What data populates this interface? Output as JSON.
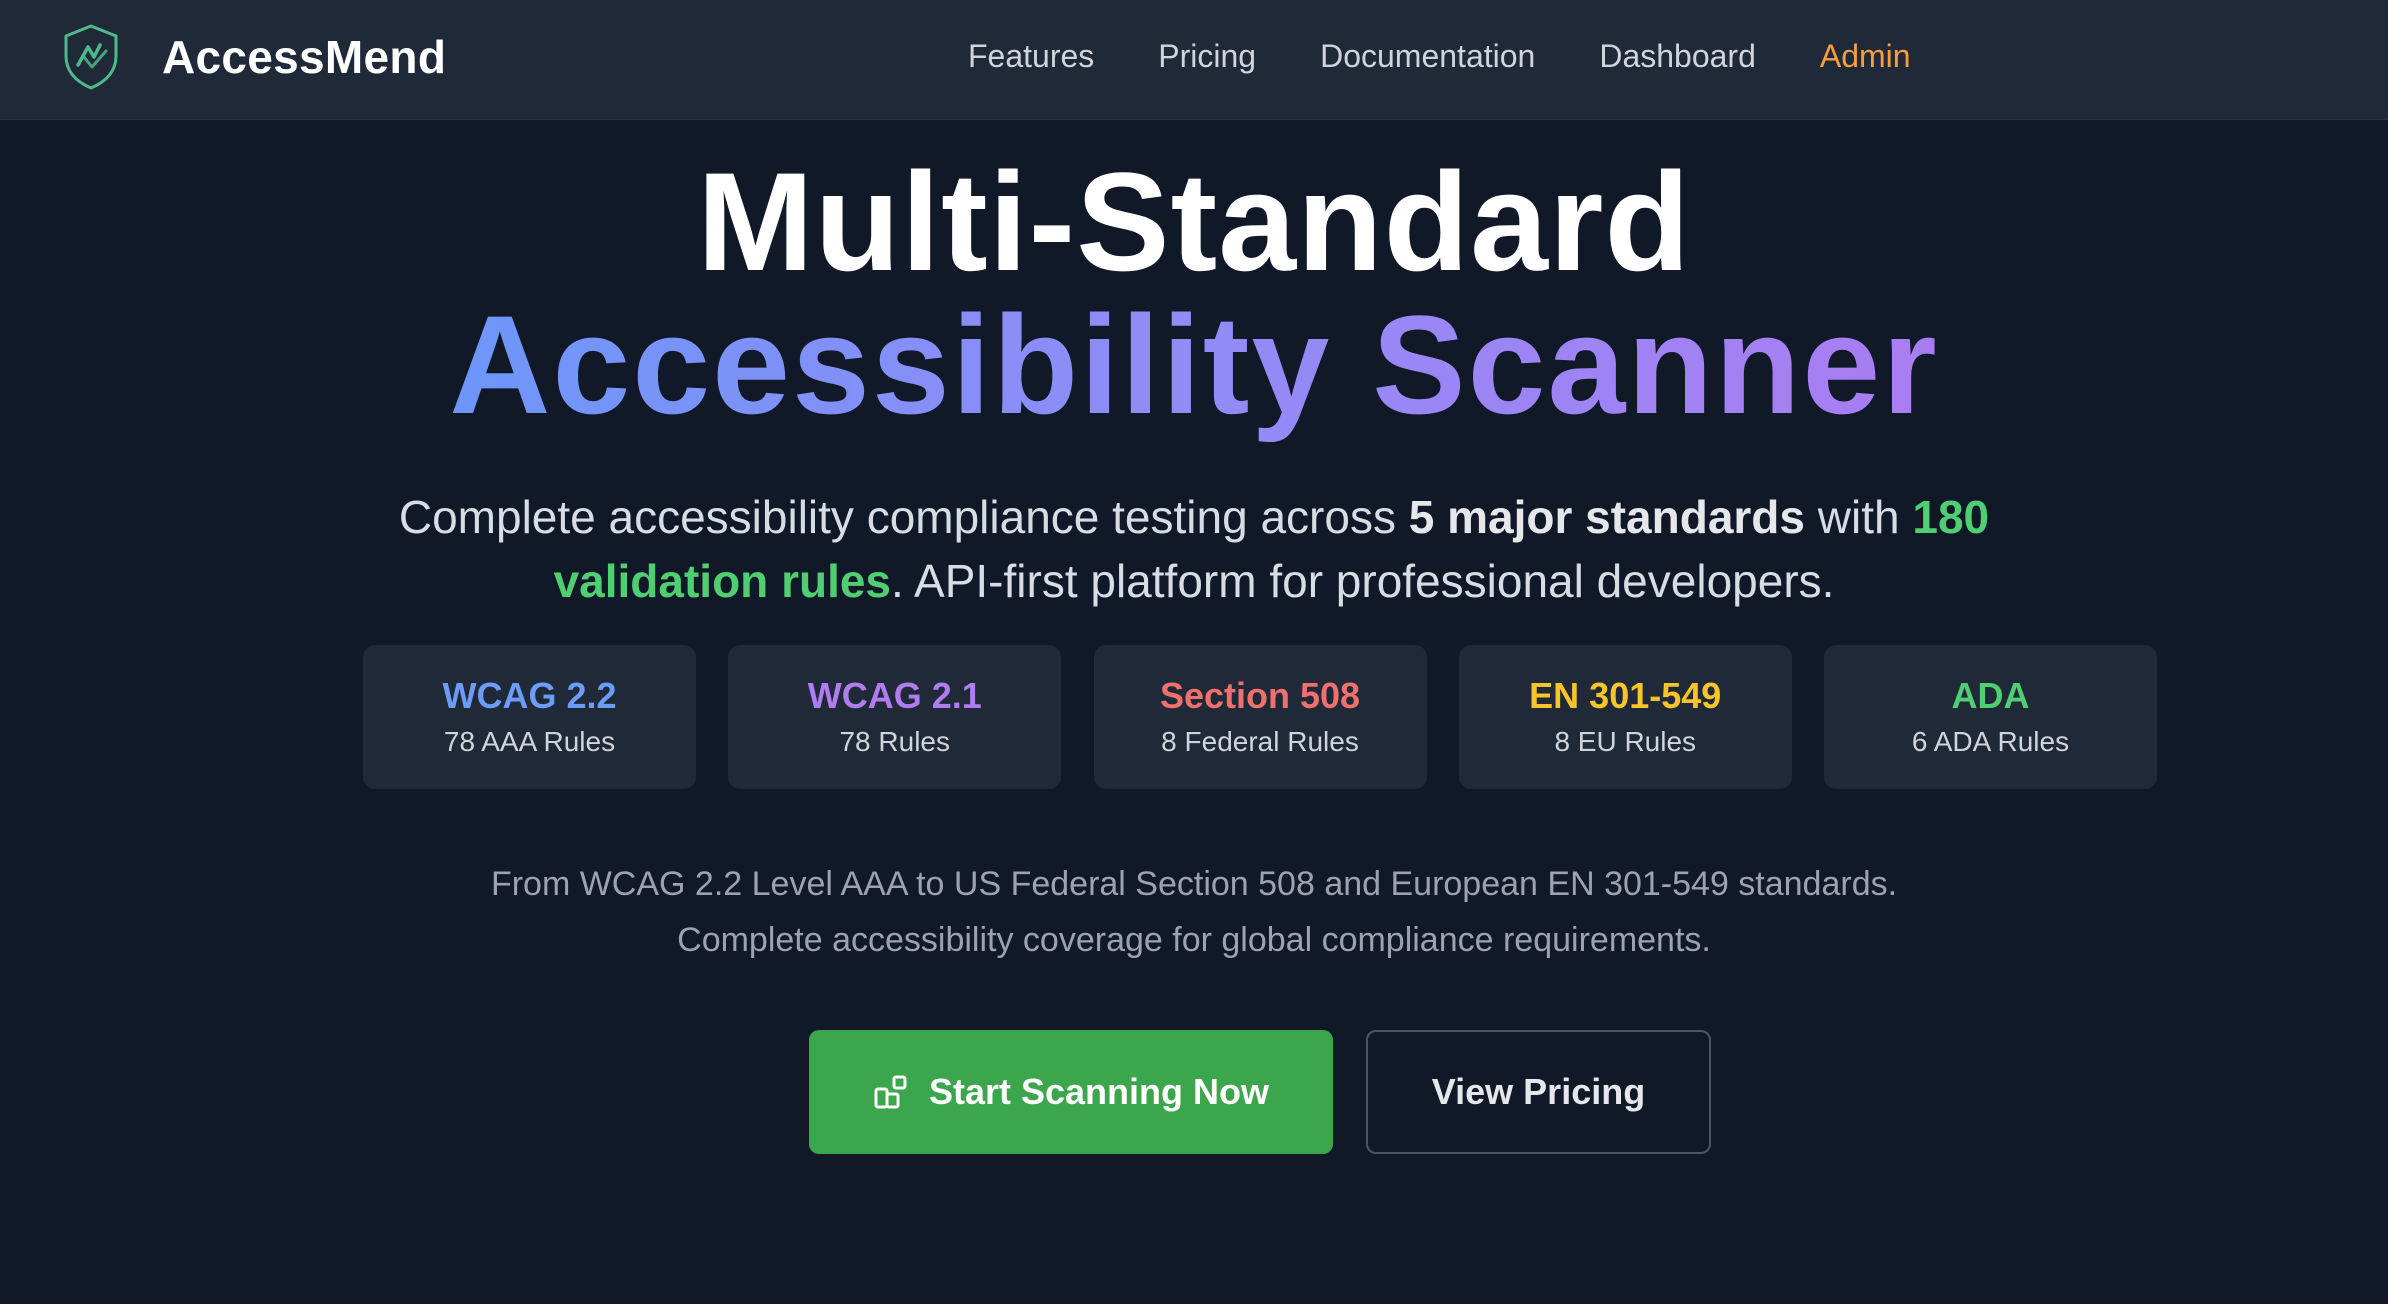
{
  "brand": {
    "name": "AccessMend",
    "logo_icon": "shield-check-icon",
    "logo_color": "#4fb98a"
  },
  "nav": {
    "items": [
      {
        "label": "Features"
      },
      {
        "label": "Pricing"
      },
      {
        "label": "Documentation"
      },
      {
        "label": "Dashboard"
      },
      {
        "label": "Admin",
        "color": "#f59e3b"
      }
    ]
  },
  "hero": {
    "title_line1": "Multi-Standard",
    "title_line2": "Accessibility Scanner",
    "title_gradient": [
      "#6d96f8",
      "#a97df2"
    ],
    "subtitle": {
      "part1": "Complete accessibility compliance testing across ",
      "strong": "5 major standards",
      "part2": " with ",
      "highlight": "180 validation rules",
      "part3": ". API-first platform for professional developers."
    }
  },
  "standards": [
    {
      "name": "WCAG 2.2",
      "rules": "78 AAA Rules",
      "color": "#6d9cf7"
    },
    {
      "name": "WCAG 2.1",
      "rules": "78 Rules",
      "color": "#b07cf0"
    },
    {
      "name": "Section 508",
      "rules": "8 Federal Rules",
      "color": "#f0706d"
    },
    {
      "name": "EN 301-549",
      "rules": "8 EU Rules",
      "color": "#f7c52a"
    },
    {
      "name": "ADA",
      "rules": "6 ADA Rules",
      "color": "#4fcf72"
    }
  ],
  "note": {
    "line1": "From WCAG 2.2 Level AAA to US Federal Section 508 and European EN 301-549 standards.",
    "line2": "Complete accessibility coverage for global compliance requirements."
  },
  "cta": {
    "primary_label": "Start Scanning Now",
    "primary_icon": "blocks-icon",
    "primary_color": "#3ba64b",
    "secondary_label": "View Pricing"
  }
}
